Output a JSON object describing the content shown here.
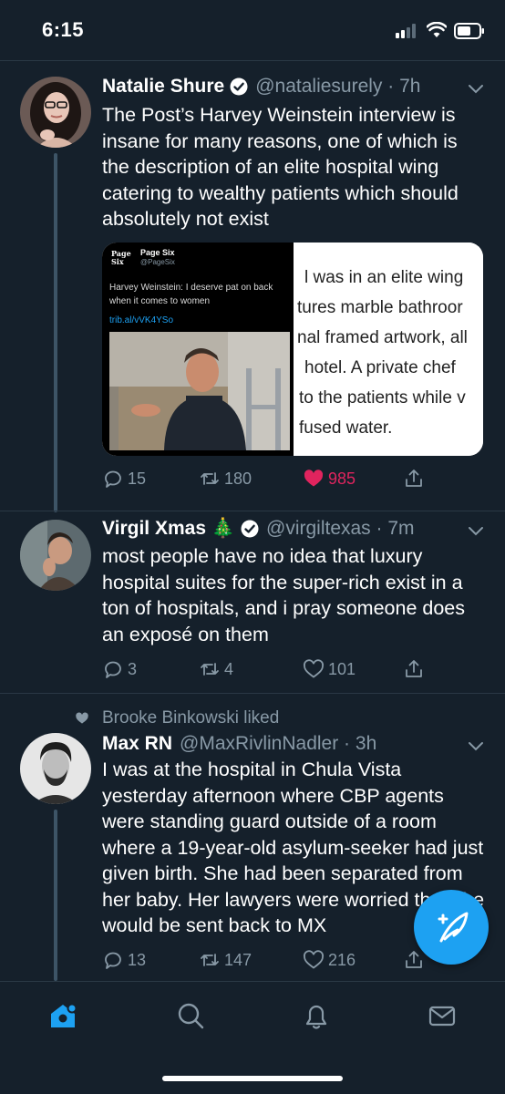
{
  "status_bar": {
    "time": "6:15"
  },
  "tweets": [
    {
      "name": "Natalie Shure",
      "verified": true,
      "handle": "@nataliesurely · 7h",
      "text": "The Post’s Harvey Weinstein interview is insane for many reasons, one of which is the description of an elite hospital wing catering to wealthy patients which should absolutely not exist",
      "media": {
        "left_panel": {
          "logo": "Page Six",
          "account_name": "Page Six",
          "account_handle": "@PageSix",
          "headline": "Harvey Weinstein: I deserve pat on back when it comes to women",
          "link": "trib.al/vVK4YSo"
        },
        "right_panel_lines": [
          "l was in an elite wing",
          "tures marble bathroor",
          "nal framed artwork, all",
          "hotel. A private chef",
          "to the patients while v",
          "fused water."
        ]
      },
      "replies": "15",
      "retweets": "180",
      "likes": "985",
      "liked": true
    },
    {
      "name": "Virgil Xmas 🎄",
      "verified": true,
      "handle": "@virgiltexas · 7m",
      "text": "most people have no idea that luxury hospital suites for the super-rich exist in a ton of hospitals, and i pray someone does an exposé on them",
      "replies": "3",
      "retweets": "4",
      "likes": "101",
      "liked": false
    },
    {
      "context": "Brooke Binkowski liked",
      "name": "Max RN",
      "verified": false,
      "handle": "@MaxRivlinNadler · 3h",
      "text": "I was at the hospital in Chula Vista yesterday afternoon where CBP agents were standing guard outside of a room where a 19-year-old asylum-seeker had just given birth. She had been separated from her baby. Her lawyers were worried that she would be sent back to MX",
      "replies": "13",
      "retweets": "147",
      "likes": "216",
      "liked": false
    }
  ],
  "icons": {
    "reply": "reply-icon",
    "retweet": "retweet-icon",
    "like": "heart-icon",
    "share": "share-icon",
    "compose": "compose-feather-icon",
    "nav": [
      "home-icon",
      "search-icon",
      "notifications-icon",
      "messages-icon"
    ]
  },
  "colors": {
    "background": "#15202b",
    "accent": "#1da1f2",
    "like": "#e0245e",
    "secondary_text": "#8899a6"
  }
}
